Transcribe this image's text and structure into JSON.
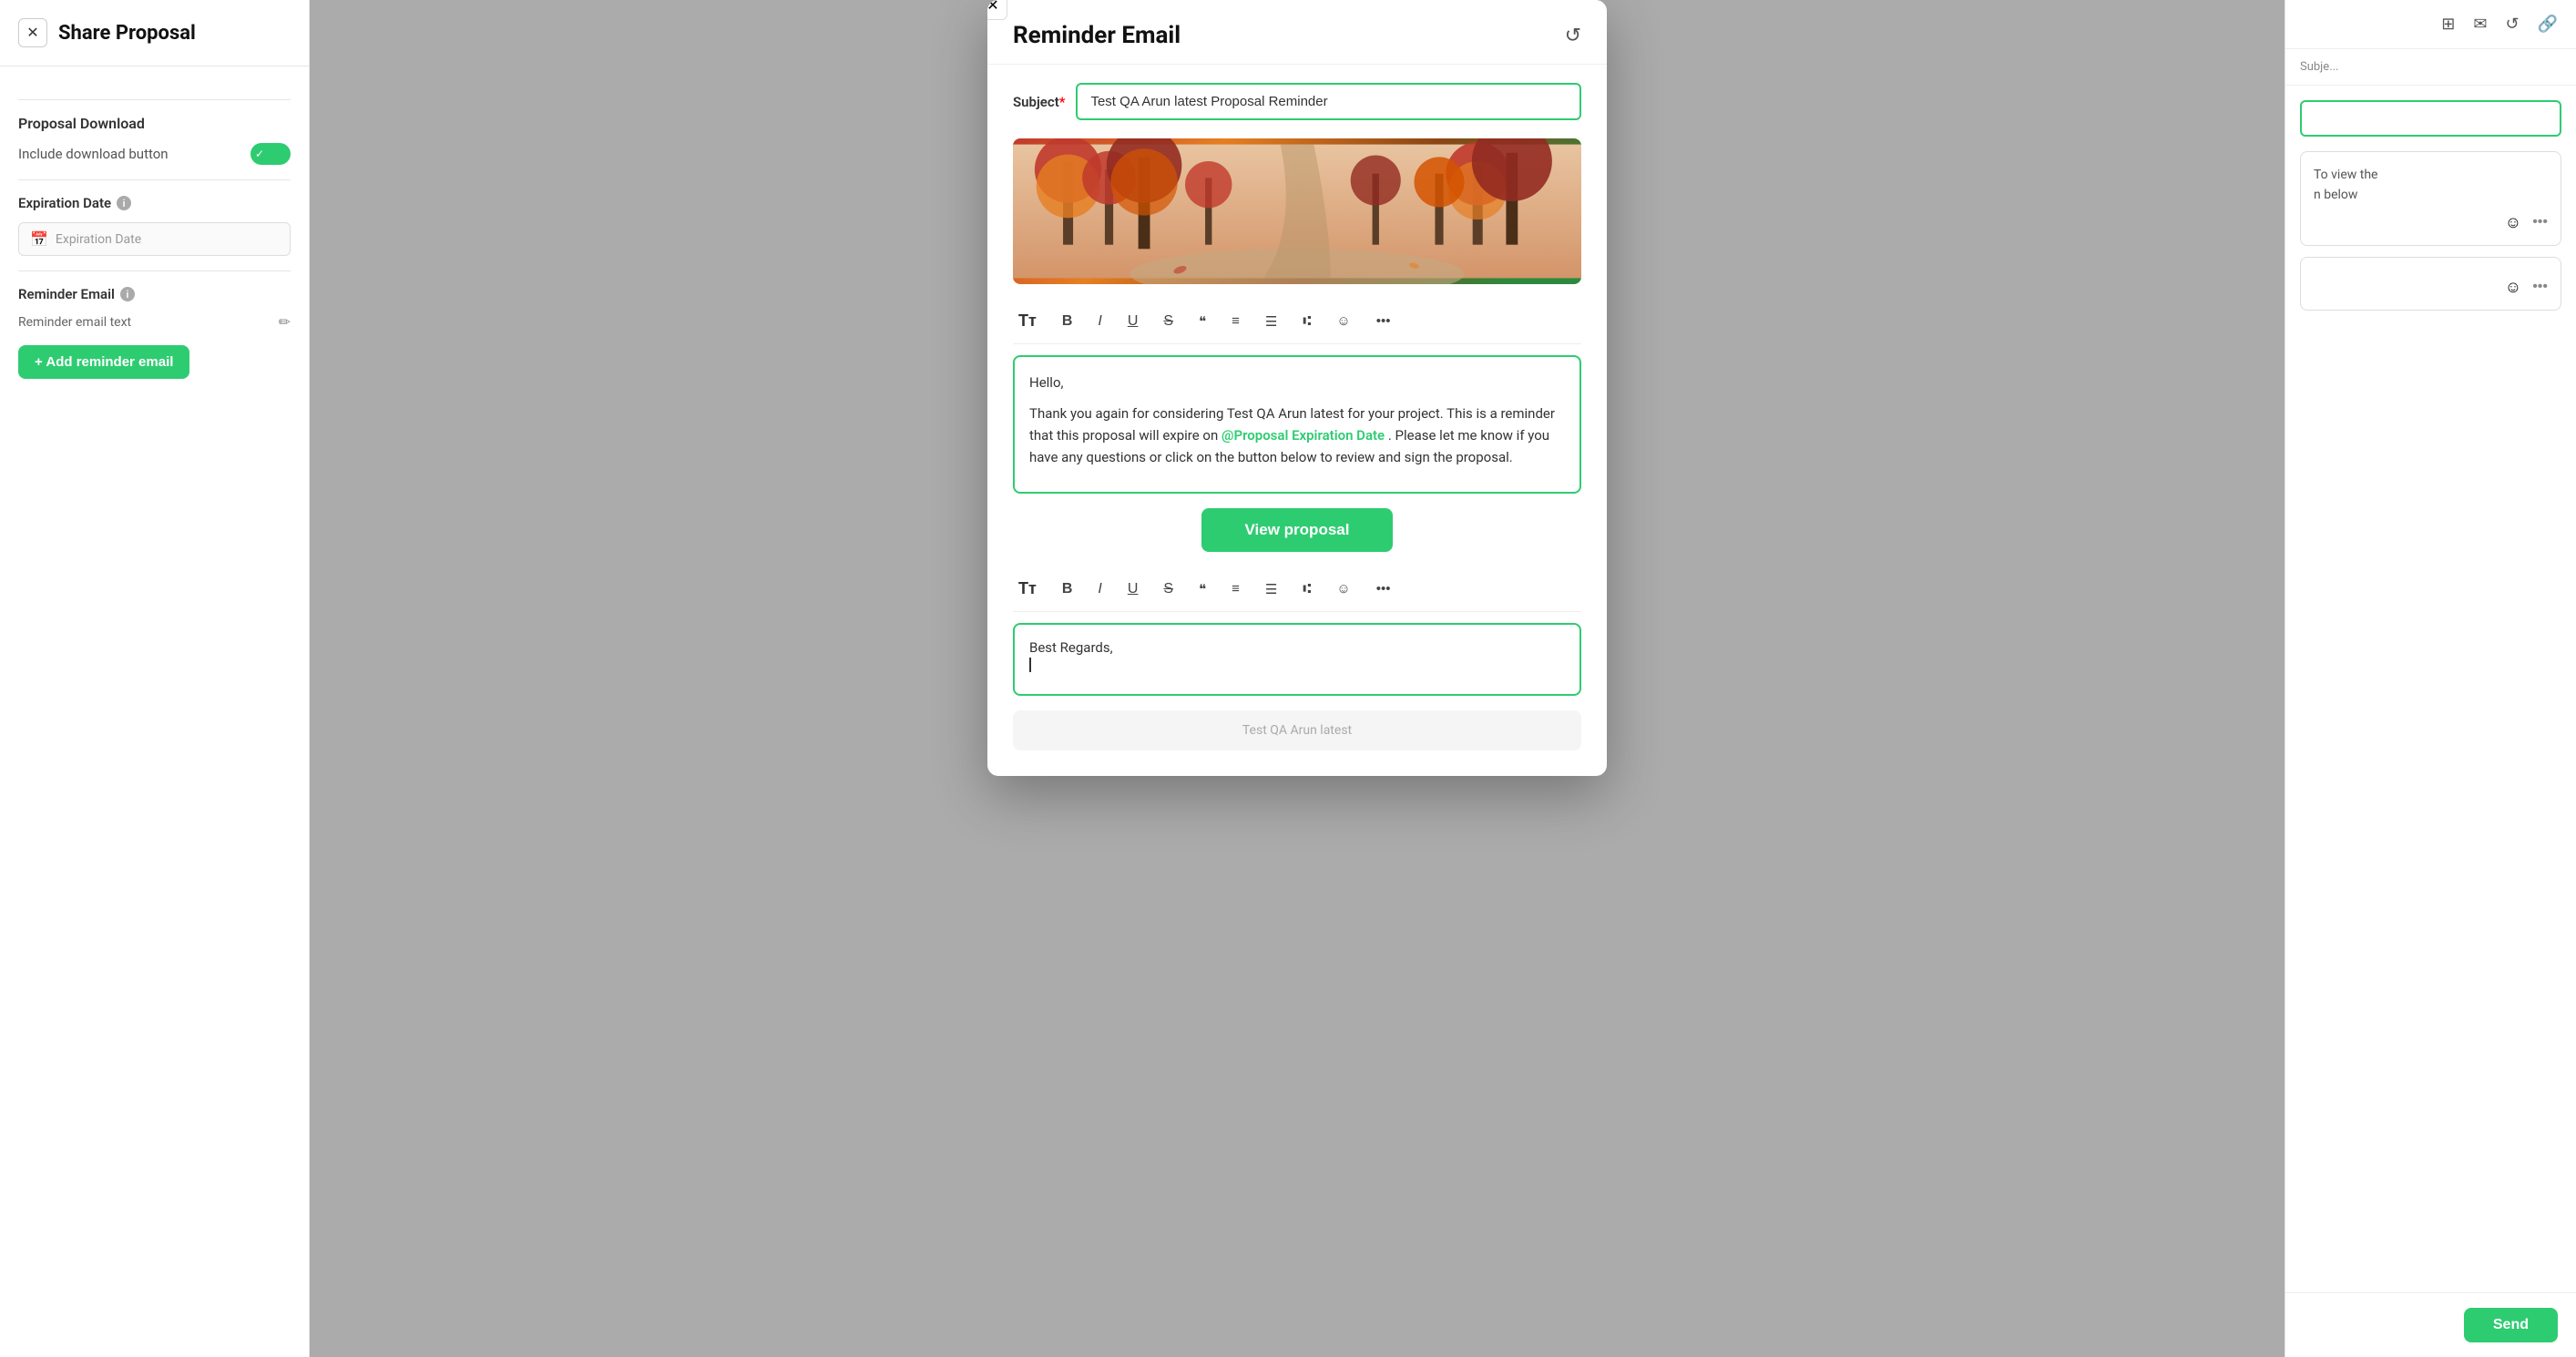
{
  "leftPanel": {
    "closeBtn": "✕",
    "title": "Share Proposal",
    "sections": {
      "proposalDownload": {
        "heading": "Proposal Download",
        "toggleLabel": "Include download button",
        "toggleEnabled": true
      },
      "expirationDate": {
        "heading": "Expiration Date",
        "placeholder": "Expiration Date"
      },
      "reminderEmail": {
        "heading": "Reminder Email",
        "textLabel": "Reminder email text",
        "addBtnLabel": "+ Add reminder email"
      }
    }
  },
  "modal": {
    "closeBtn": "✕",
    "title": "Reminder Email",
    "resetBtn": "↺",
    "subjectLabel": "Subject",
    "subjectRequired": "*",
    "subjectValue": "Test QA Arun latest Proposal Reminder",
    "emailBody": {
      "greeting": "Hello,",
      "line1": "Thank you again for considering Test QA Arun latest for your project. This is a reminder that this proposal will expire on",
      "expiryTag": "@Proposal Expiration Date",
      "line2": ". Please let me know if you have any questions or click on the button below to review and sign the proposal.",
      "viewBtnLabel": "View proposal",
      "closing": "Best Regards,"
    },
    "footerText": "Test QA Arun latest",
    "toolbar": {
      "textFormat": "Tᴛ",
      "bold": "B",
      "italic": "I",
      "underline": "U",
      "strikethrough": "S",
      "quote": "❝",
      "align": "≡",
      "bulletList": "☰",
      "numberedList": "⑆",
      "emoji": "☺",
      "more": "•••"
    }
  },
  "rightPanel": {
    "toolbar": {
      "gridIcon": "⊞",
      "emailIcon": "✉",
      "undoIcon": "↺",
      "linkIcon": "🔗"
    },
    "subjectPlaceholder": "Subje...",
    "card1Text": "To view the\nn below",
    "sendBtn": "Send"
  }
}
